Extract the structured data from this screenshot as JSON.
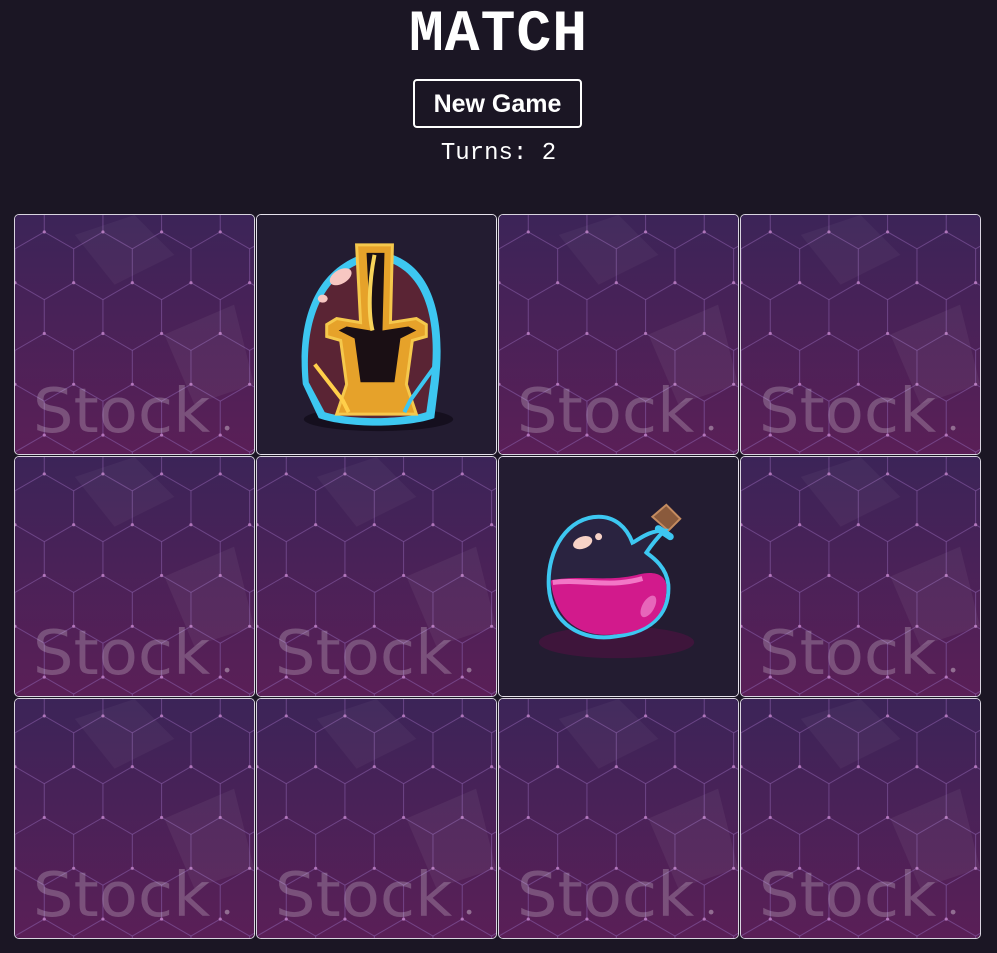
{
  "game": {
    "title": "MATCH",
    "new_game_label": "New Game",
    "turns_label": "Turns: ",
    "turns": "2"
  },
  "card_back": {
    "watermark": "Stock",
    "colors": {
      "top": "#3c2458",
      "bottom": "#5a1f57",
      "line": "#8a5fa8",
      "dot": "#d08fd6"
    }
  },
  "cards": [
    {
      "state": "down",
      "face": ""
    },
    {
      "state": "up",
      "face": "helmet-icon"
    },
    {
      "state": "down",
      "face": ""
    },
    {
      "state": "down",
      "face": ""
    },
    {
      "state": "down",
      "face": ""
    },
    {
      "state": "down",
      "face": ""
    },
    {
      "state": "up",
      "face": "potion-icon"
    },
    {
      "state": "down",
      "face": ""
    },
    {
      "state": "down",
      "face": ""
    },
    {
      "state": "down",
      "face": ""
    },
    {
      "state": "down",
      "face": ""
    },
    {
      "state": "down",
      "face": ""
    }
  ]
}
